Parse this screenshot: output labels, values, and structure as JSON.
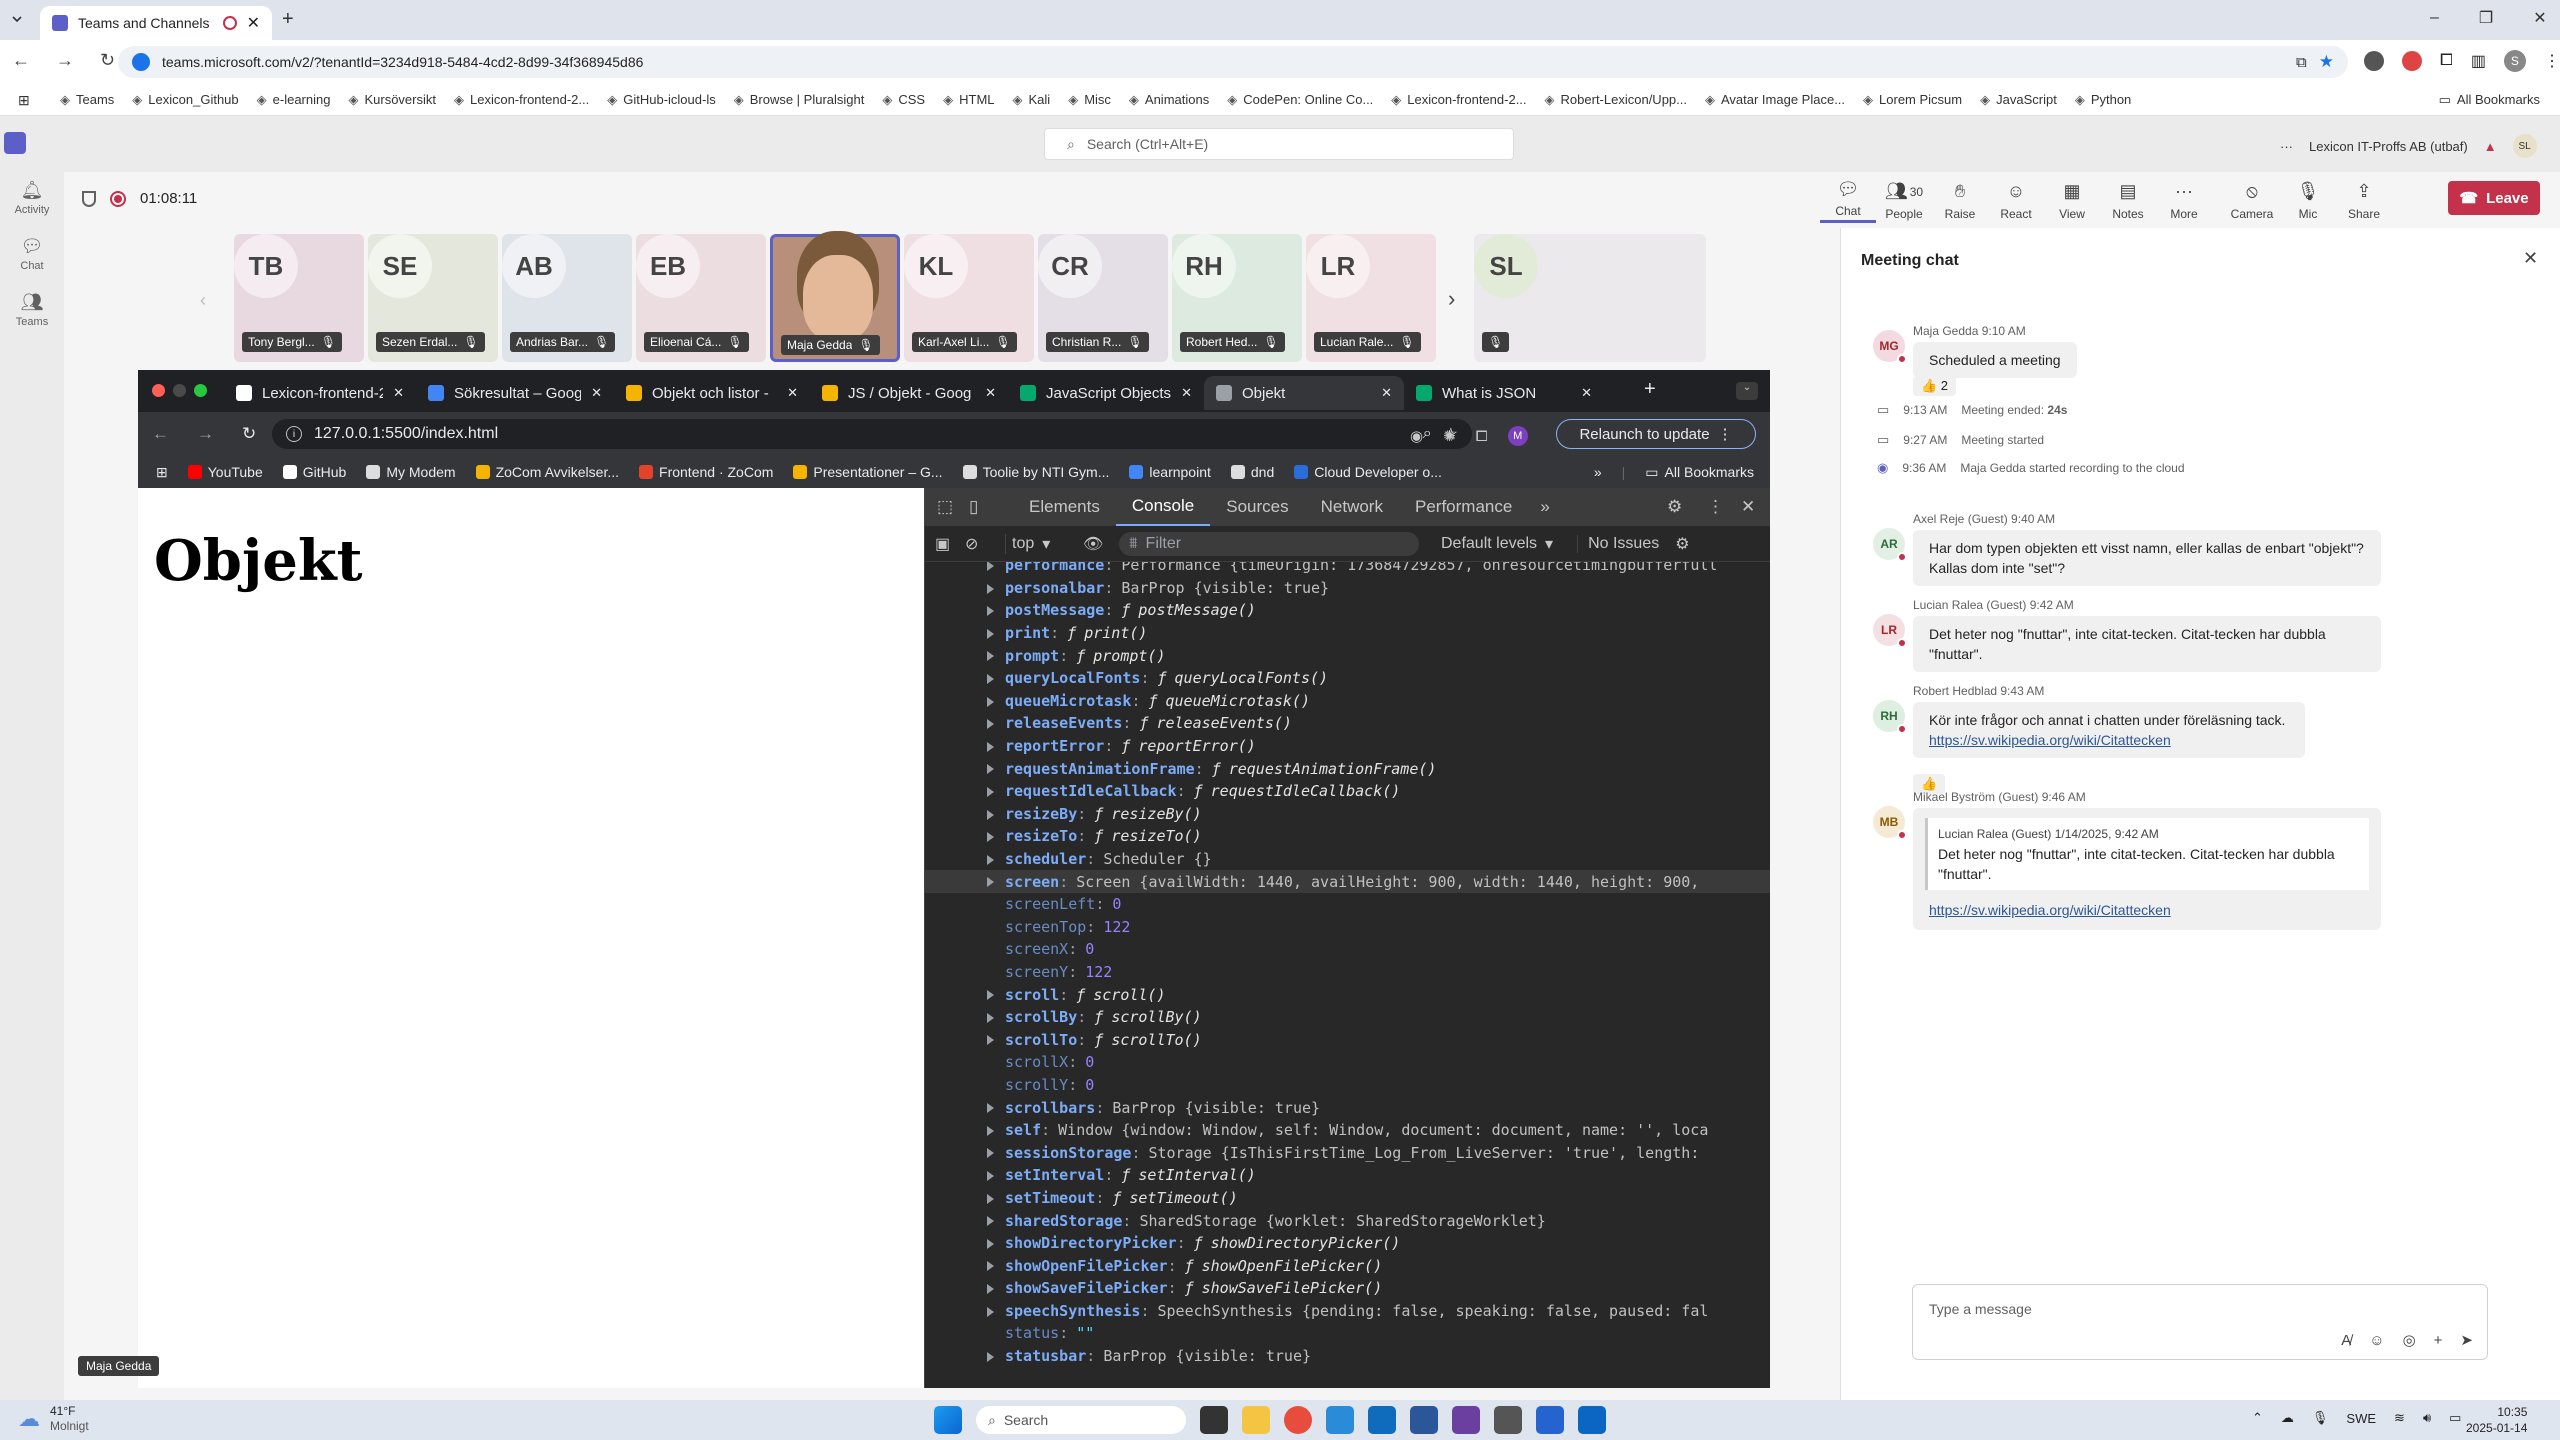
{
  "browser": {
    "tab_title": "Teams and Channels | Före",
    "url": "teams.microsoft.com/v2/?tenantId=3234d918-5484-4cd2-8d99-34f368945d86",
    "bookmarks": [
      "Teams",
      "Lexicon_Github",
      "e-learning",
      "Kursöversikt",
      "Lexicon-frontend-2...",
      "GitHub-icloud-ls",
      "Browse | Pluralsight",
      "CSS",
      "HTML",
      "Kali",
      "Misc",
      "Animations",
      "CodePen: Online Co...",
      "Lexicon-frontend-2...",
      "Robert-Lexicon/Upp...",
      "Avatar Image Place...",
      "Lorem Picsum",
      "JavaScript",
      "Python"
    ],
    "all_bookmarks": "All Bookmarks"
  },
  "teams": {
    "search_placeholder": "Search (Ctrl+Alt+E)",
    "org": "Lexicon IT-Proffs AB (utbaf)",
    "user_initial": "SL",
    "rail": [
      {
        "label": "Activity"
      },
      {
        "label": "Chat"
      },
      {
        "label": "Teams"
      }
    ],
    "timer": "01:08:11",
    "toolbar": [
      {
        "label": "Chat",
        "icon": "chat-icon",
        "badge": ""
      },
      {
        "label": "People",
        "icon": "people-icon",
        "badge": "30"
      },
      {
        "label": "Raise",
        "icon": "hand-icon",
        "badge": ""
      },
      {
        "label": "React",
        "icon": "smile-icon",
        "badge": ""
      },
      {
        "label": "View",
        "icon": "grid-icon",
        "badge": ""
      },
      {
        "label": "Notes",
        "icon": "notes-icon",
        "badge": ""
      },
      {
        "label": "More",
        "icon": "more-icon",
        "badge": ""
      },
      {
        "label": "Camera",
        "icon": "camera-off-icon",
        "badge": ""
      },
      {
        "label": "Mic",
        "icon": "mic-off-icon",
        "badge": ""
      },
      {
        "label": "Share",
        "icon": "share-icon",
        "badge": ""
      }
    ],
    "leave": "Leave",
    "participants": [
      {
        "initials": "TB",
        "name": "Tony Bergl...",
        "color": "#e8d8e0"
      },
      {
        "initials": "SE",
        "name": "Sezen Erdal...",
        "color": "#e4e8dc"
      },
      {
        "initials": "AB",
        "name": "Andrias Bar...",
        "color": "#dfe3ea"
      },
      {
        "initials": "EB",
        "name": "Elioenai Cá...",
        "color": "#ecdde0"
      },
      {
        "initials": "",
        "name": "Maja Gedda",
        "color": "#b78f7a"
      },
      {
        "initials": "KL",
        "name": "Karl-Axel Li...",
        "color": "#efdfe2"
      },
      {
        "initials": "CR",
        "name": "Christian R...",
        "color": "#e4dfe6"
      },
      {
        "initials": "RH",
        "name": "Robert Hed...",
        "color": "#dceadf"
      },
      {
        "initials": "LR",
        "name": "Lucian Rale...",
        "color": "#f0dfe3"
      }
    ],
    "self_tile": {
      "initials": "SL"
    },
    "presenter_label": "Maja Gedda"
  },
  "shared": {
    "tabs": [
      "Lexicon-frontend-2",
      "Sökresultat – Goog",
      "Objekt och listor -",
      "JS / Objekt - Goog",
      "JavaScript Objects",
      "Objekt",
      "What is JSON"
    ],
    "url": "127.0.0.1:5500/index.html",
    "relaunch": "Relaunch to update",
    "bookmarks": [
      "YouTube",
      "GitHub",
      "My Modem",
      "ZoCom Avvikelser...",
      "Frontend · ZoCom",
      "Presentationer – G...",
      "Toolie by NTI Gym...",
      "learnpoint",
      "dnd",
      "Cloud Developer o..."
    ],
    "all_bookmarks": "All Bookmarks",
    "page_heading": "Objekt",
    "devtools": {
      "tabs": [
        "Elements",
        "Console",
        "Sources",
        "Network",
        "Performance"
      ],
      "context": "top",
      "filter_placeholder": "Filter",
      "levels": "Default levels",
      "issues": "No Issues"
    },
    "console_lines": [
      {
        "key": "performance",
        "val": "Performance {timeOrigin: 1736847292857, onresourcetimingbufferfull",
        "type": "obj",
        "expand": true
      },
      {
        "key": "personalbar",
        "val": "BarProp {visible: true}",
        "type": "obj",
        "expand": true
      },
      {
        "key": "postMessage",
        "val": "postMessage()",
        "type": "fn",
        "expand": true
      },
      {
        "key": "print",
        "val": "print()",
        "type": "fn",
        "expand": true
      },
      {
        "key": "prompt",
        "val": "prompt()",
        "type": "fn",
        "expand": true
      },
      {
        "key": "queryLocalFonts",
        "val": "queryLocalFonts()",
        "type": "fn",
        "expand": true
      },
      {
        "key": "queueMicrotask",
        "val": "queueMicrotask()",
        "type": "fn",
        "expand": true
      },
      {
        "key": "releaseEvents",
        "val": "releaseEvents()",
        "type": "fn",
        "expand": true
      },
      {
        "key": "reportError",
        "val": "reportError()",
        "type": "fn",
        "expand": true
      },
      {
        "key": "requestAnimationFrame",
        "val": "requestAnimationFrame()",
        "type": "fn",
        "expand": true
      },
      {
        "key": "requestIdleCallback",
        "val": "requestIdleCallback()",
        "type": "fn",
        "expand": true
      },
      {
        "key": "resizeBy",
        "val": "resizeBy()",
        "type": "fn",
        "expand": true
      },
      {
        "key": "resizeTo",
        "val": "resizeTo()",
        "type": "fn",
        "expand": true
      },
      {
        "key": "scheduler",
        "val": "Scheduler {}",
        "type": "obj",
        "expand": true
      },
      {
        "key": "screen",
        "val": "Screen {availWidth: 1440, availHeight: 900, width: 1440, height: 900,",
        "type": "obj",
        "expand": true,
        "hl": true
      },
      {
        "key": "screenLeft",
        "val": "0",
        "type": "num",
        "expand": false
      },
      {
        "key": "screenTop",
        "val": "122",
        "type": "num",
        "expand": false
      },
      {
        "key": "screenX",
        "val": "0",
        "type": "num",
        "expand": false
      },
      {
        "key": "screenY",
        "val": "122",
        "type": "num",
        "expand": false
      },
      {
        "key": "scroll",
        "val": "scroll()",
        "type": "fn",
        "expand": true
      },
      {
        "key": "scrollBy",
        "val": "scrollBy()",
        "type": "fn",
        "expand": true
      },
      {
        "key": "scrollTo",
        "val": "scrollTo()",
        "type": "fn",
        "expand": true
      },
      {
        "key": "scrollX",
        "val": "0",
        "type": "num",
        "expand": false
      },
      {
        "key": "scrollY",
        "val": "0",
        "type": "num",
        "expand": false
      },
      {
        "key": "scrollbars",
        "val": "BarProp {visible: true}",
        "type": "obj",
        "expand": true
      },
      {
        "key": "self",
        "val": "Window {window: Window, self: Window, document: document, name: '', loca",
        "type": "obj",
        "expand": true
      },
      {
        "key": "sessionStorage",
        "val": "Storage {IsThisFirstTime_Log_From_LiveServer: 'true', length:",
        "type": "obj",
        "expand": true
      },
      {
        "key": "setInterval",
        "val": "setInterval()",
        "type": "fn",
        "expand": true
      },
      {
        "key": "setTimeout",
        "val": "setTimeout()",
        "type": "fn",
        "expand": true
      },
      {
        "key": "sharedStorage",
        "val": "SharedStorage {worklet: SharedStorageWorklet}",
        "type": "obj",
        "expand": true
      },
      {
        "key": "showDirectoryPicker",
        "val": "showDirectoryPicker()",
        "type": "fn",
        "expand": true
      },
      {
        "key": "showOpenFilePicker",
        "val": "showOpenFilePicker()",
        "type": "fn",
        "expand": true
      },
      {
        "key": "showSaveFilePicker",
        "val": "showSaveFilePicker()",
        "type": "fn",
        "expand": true
      },
      {
        "key": "speechSynthesis",
        "val": "SpeechSynthesis {pending: false, speaking: false, paused: fal",
        "type": "obj",
        "expand": true
      },
      {
        "key": "status",
        "val": "\"\"",
        "type": "str",
        "expand": false
      },
      {
        "key": "statusbar",
        "val": "BarProp {visible: true}",
        "type": "obj",
        "expand": true
      }
    ]
  },
  "chat": {
    "title": "Meeting chat",
    "compose_placeholder": "Type a message",
    "m1": {
      "initials": "MG",
      "meta": "Maja Gedda  9:10 AM",
      "text": "Scheduled a meeting",
      "reaction": "👍 2"
    },
    "sys": [
      {
        "time": "9:13 AM",
        "text": "Meeting ended: ",
        "bold": "24s",
        "icon": "video-icon"
      },
      {
        "time": "9:27 AM",
        "text": "Meeting started",
        "bold": "",
        "icon": "video-icon"
      },
      {
        "time": "9:36 AM",
        "text": "Maja Gedda started recording to the cloud",
        "bold": "",
        "icon": "record-icon"
      }
    ],
    "m2": {
      "initials": "AR",
      "meta": "Axel Reje (Guest)  9:40 AM",
      "text": "Har dom typen objekten ett visst namn, eller kallas de enbart \"objekt\"? Kallas dom inte \"set\"?"
    },
    "m3": {
      "initials": "LR",
      "meta": "Lucian Ralea (Guest)  9:42 AM",
      "text": "Det heter nog \"fnuttar\", inte citat-tecken. Citat-tecken har dubbla \"fnuttar\"."
    },
    "m4": {
      "initials": "RH",
      "meta": "Robert Hedblad  9:43 AM",
      "text": "Kör inte frågor och annat i chatten under föreläsning tack.",
      "link": "https://sv.wikipedia.org/wiki/Citattecken",
      "reaction": "👍"
    },
    "m5": {
      "initials": "MB",
      "meta": "Mikael Byström (Guest)  9:46 AM",
      "quote_meta": "Lucian Ralea (Guest)  1/14/2025, 9:42 AM",
      "quote_text": "Det heter nog \"fnuttar\", inte citat-tecken. Citat-tecken har dubbla \"fnuttar\".",
      "link": "https://sv.wikipedia.org/wiki/Citattecken"
    }
  },
  "taskbar": {
    "temp": "41°F",
    "weather": "Molnigt",
    "search": "Search",
    "lang": "SWE",
    "time": "10:35",
    "date": "2025-01-14"
  }
}
